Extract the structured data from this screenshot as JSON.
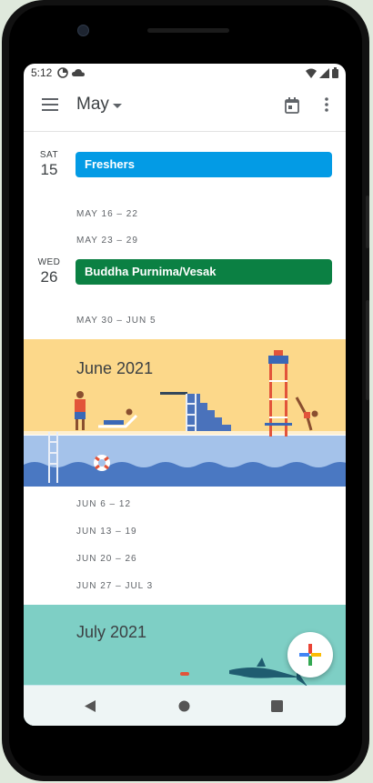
{
  "status_bar": {
    "time": "5:12"
  },
  "app_bar": {
    "month": "May"
  },
  "days": [
    {
      "dow": "SAT",
      "dom": "15",
      "event": "Freshers",
      "color": "#039be5"
    },
    {
      "dow": "WED",
      "dom": "26",
      "event": "Buddha Purnima/Vesak",
      "color": "#0b8043"
    }
  ],
  "weeks_may": [
    "MAY 16 – 22",
    "MAY 23 – 29",
    "MAY 30 – JUN 5"
  ],
  "june_banner": {
    "title": "June 2021"
  },
  "weeks_june": [
    "JUN 6 – 12",
    "JUN 13 – 19",
    "JUN 20 – 26",
    "JUN 27 – JUL 3"
  ],
  "july_banner": {
    "title": "July 2021"
  },
  "colors": {
    "june_sky": "#fcd88a",
    "pool": "#a4c2ea",
    "july_bg": "#7ecfc5"
  }
}
